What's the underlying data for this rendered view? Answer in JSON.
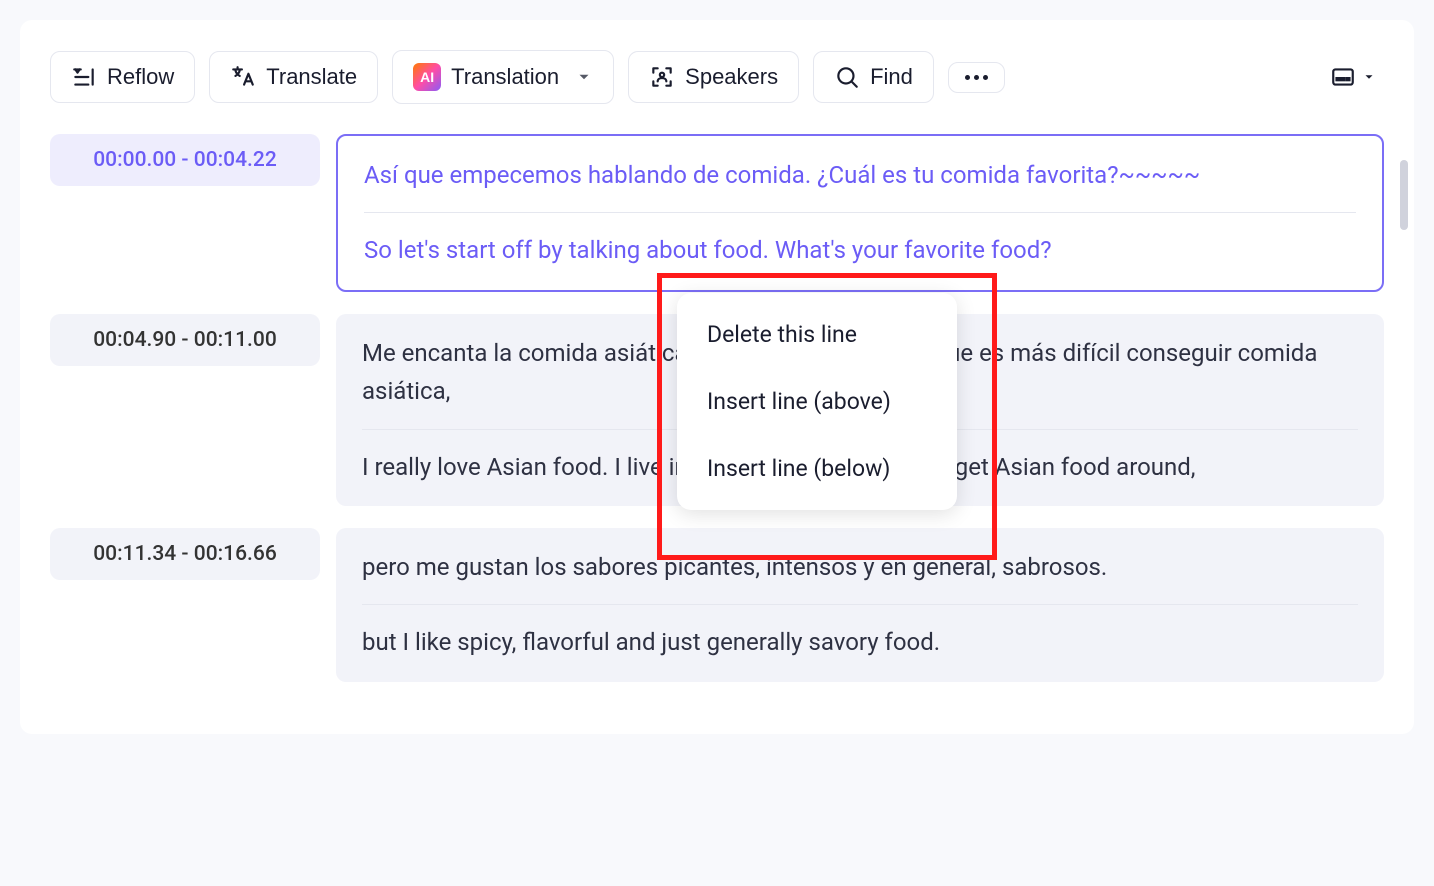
{
  "toolbar": {
    "reflow_label": "Reflow",
    "translate_label": "Translate",
    "translation_label": "Translation",
    "speakers_label": "Speakers",
    "find_label": "Find"
  },
  "segments": [
    {
      "timestamp": "00:00.00 - 00:04.22",
      "source": "Así que empecemos hablando de comida. ¿Cuál es tu comida favorita?~~~~~",
      "translation": "So let's start off by talking about food. What's your favorite food?",
      "active": true
    },
    {
      "timestamp": "00:04.90  -  00:11.00",
      "source": "Me encanta la comida asiática. Vivo en Inglaterra, así que es más difícil conseguir comida asiática,",
      "translation": "I really love Asian food. I live in England so it's harder to get Asian food around,",
      "active": false
    },
    {
      "timestamp": "00:11.34  -  00:16.66",
      "source": "pero me gustan los sabores picantes, intensos y en general, sabrosos.",
      "translation": "but I like spicy, flavorful and just generally savory food.",
      "active": false
    }
  ],
  "context_menu": {
    "items": [
      "Delete this line",
      "Insert line (above)",
      "Insert line (below)"
    ]
  }
}
